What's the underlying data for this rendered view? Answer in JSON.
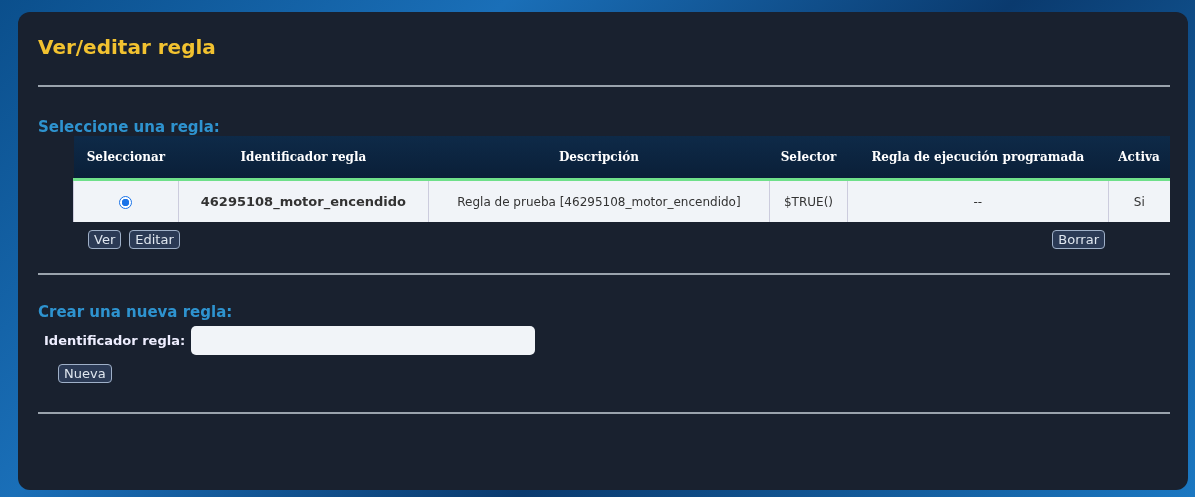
{
  "title": "Ver/editar regla",
  "select_section": {
    "heading": "Seleccione una regla:",
    "table": {
      "columns": [
        "Seleccionar",
        "Identificador regla",
        "Descripción",
        "Selector",
        "Regla de ejecución programada",
        "Activa"
      ],
      "rows": [
        {
          "cells": [
            {
              "kind": "radio",
              "selected": true
            },
            "46295108_motor_encendido",
            "Regla de prueba [46295108_motor_encendido]",
            "$TRUE()",
            "--",
            "Si"
          ]
        }
      ]
    },
    "buttons": [
      "Ver",
      "Editar"
    ],
    "delete_button": "Borrar"
  },
  "create_section": {
    "heading": "Crear una nueva regla:",
    "field_label": "Identificador regla:",
    "button": "Nueva"
  }
}
